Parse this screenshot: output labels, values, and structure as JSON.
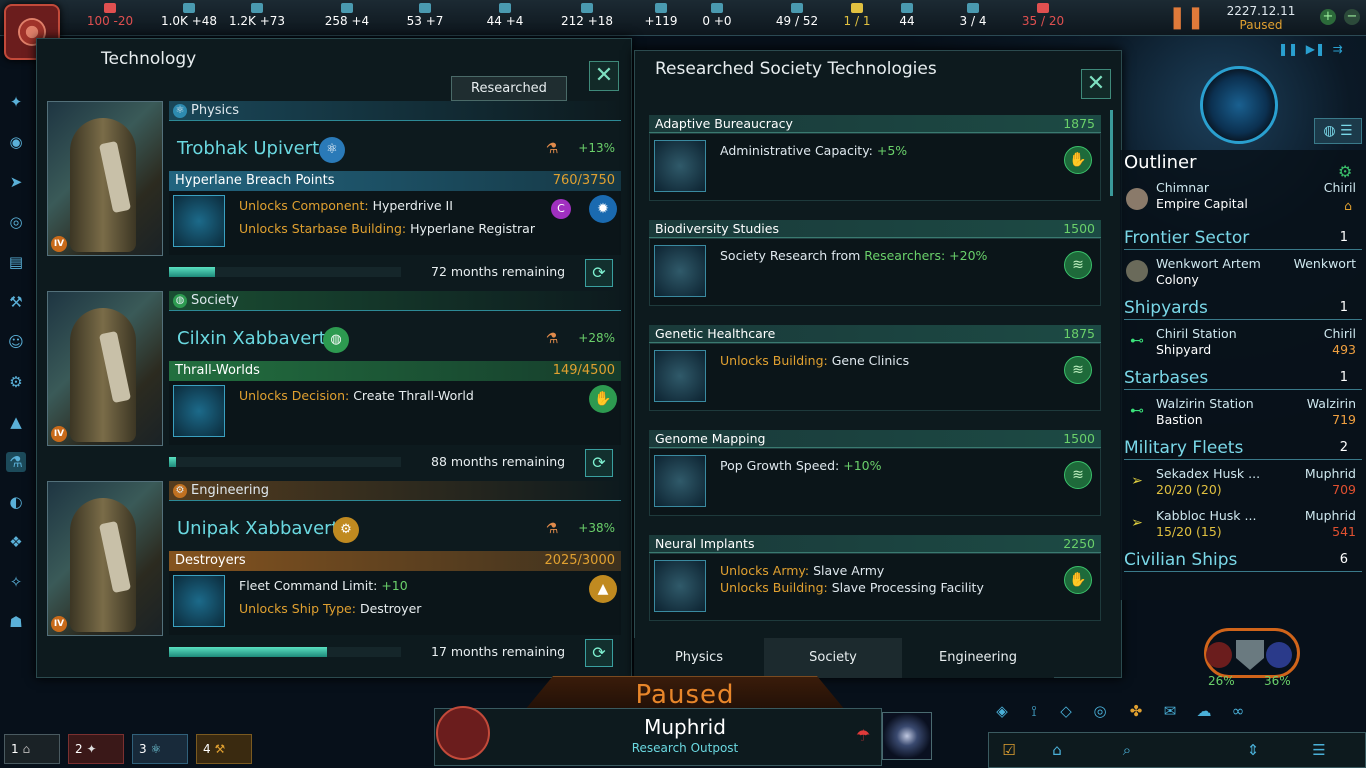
{
  "top_bar": {
    "resources": [
      {
        "name": "energy",
        "value": "100 -20",
        "color": "#e05050",
        "icon": "energy-icon"
      },
      {
        "name": "minerals",
        "value": "1.0K +48",
        "color": "#ffffff",
        "icon": "minerals-icon"
      },
      {
        "name": "food",
        "value": "1.2K +73",
        "color": "#ffffff",
        "icon": "food-icon"
      },
      {
        "name": "consumer_goods",
        "value": "258 +4",
        "color": "#ffffff",
        "icon": "consumer-goods-icon"
      },
      {
        "name": "alloys",
        "value": "53 +7",
        "color": "#ffffff",
        "icon": "alloys-icon"
      },
      {
        "name": "influence",
        "value": "44 +4",
        "color": "#ffffff",
        "icon": "influence-icon"
      },
      {
        "name": "unity",
        "value": "212 +18",
        "color": "#ffffff",
        "icon": "unity-icon"
      },
      {
        "name": "research",
        "value": "+119",
        "color": "#ffffff",
        "icon": "research-icon"
      },
      {
        "name": "trade",
        "value": "0 +0",
        "color": "#ffffff",
        "icon": "trade-icon"
      },
      {
        "name": "naval_capacity",
        "value": "49 / 52",
        "color": "#ffffff",
        "icon": "fleet-icon"
      },
      {
        "name": "starbase_capacity",
        "value": "1 / 1",
        "color": "#e0c040",
        "icon": "starbase-icon"
      },
      {
        "name": "pops",
        "value": "44",
        "color": "#ffffff",
        "icon": "pop-icon"
      },
      {
        "name": "colonies",
        "value": "3 / 4",
        "color": "#ffffff",
        "icon": "colony-icon"
      },
      {
        "name": "empire_sprawl",
        "value": "35 / 20",
        "color": "#e05050",
        "icon": "sprawl-icon"
      }
    ],
    "date": "2227.12.11",
    "status": "Paused"
  },
  "tech_panel": {
    "title": "Technology",
    "researched_button": "Researched",
    "rows": [
      {
        "area": "Physics",
        "area_color": "#2d8ab0",
        "scientist": "Trobhak Upiverta",
        "bonus": "+13%",
        "project": "Hyperlane Breach Points",
        "progress_text": "760/3750",
        "progress": 0.2,
        "unlocks": [
          {
            "key": "Unlocks Component:",
            "value": "Hyperdrive II"
          },
          {
            "key": "Unlocks Starbase Building:",
            "value": "Hyperlane Registrar"
          }
        ],
        "remaining": "72 months remaining",
        "rank": "IV"
      },
      {
        "area": "Society",
        "area_color": "#2d9a50",
        "scientist": "Cilxin Xabbaverta",
        "bonus": "+28%",
        "project": "Thrall-Worlds",
        "progress_text": "149/4500",
        "progress": 0.03,
        "unlocks": [
          {
            "key": "Unlocks Decision:",
            "value": "Create Thrall-World"
          }
        ],
        "remaining": "88 months remaining",
        "rank": "IV"
      },
      {
        "area": "Engineering",
        "area_color": "#c07020",
        "scientist": "Unipak Xabbaverta",
        "bonus": "+38%",
        "project": "Destroyers",
        "progress_text": "2025/3000",
        "progress": 0.68,
        "unlocks": [
          {
            "key": "Fleet Command Limit:",
            "value": "+10"
          },
          {
            "key": "Unlocks Ship Type:",
            "value": "Destroyer"
          }
        ],
        "remaining": "17 months remaining",
        "rank": "IV"
      }
    ]
  },
  "researched_panel": {
    "title": "Researched Society Technologies",
    "techs": [
      {
        "name": "Adaptive Bureaucracy",
        "cost": "1875",
        "lines": [
          {
            "k": "Administrative Capacity:",
            "v": "+5%"
          }
        ]
      },
      {
        "name": "Biodiversity Studies",
        "cost": "1500",
        "lines": [
          {
            "k": "Society Research from",
            "v": "Researchers: +20%"
          }
        ]
      },
      {
        "name": "Genetic Healthcare",
        "cost": "1875",
        "lines": [
          {
            "k": "Unlocks Building:",
            "v": "Gene Clinics"
          }
        ]
      },
      {
        "name": "Genome Mapping",
        "cost": "1500",
        "lines": [
          {
            "k": "Pop Growth Speed:",
            "v": "+10%"
          }
        ]
      },
      {
        "name": "Neural Implants",
        "cost": "2250",
        "lines": [
          {
            "k": "Unlocks Army:",
            "v": "Slave Army"
          },
          {
            "k": "Unlocks Building:",
            "v": "Slave Processing Facility"
          }
        ]
      }
    ],
    "tabs": [
      "Physics",
      "Society",
      "Engineering"
    ],
    "active_tab": "Society"
  },
  "outliner": {
    "title": "Outliner",
    "capital": {
      "planet": "Chimnar",
      "system": "Chiril",
      "label": "Empire Capital"
    },
    "sections": [
      {
        "name": "Frontier Sector",
        "count": "1",
        "items": [
          {
            "a": "Wenkwort Artem",
            "b": "Colony",
            "c": "Wenkwort",
            "d": ""
          }
        ]
      },
      {
        "name": "Shipyards",
        "count": "1",
        "items": [
          {
            "a": "Chiril Station",
            "b": "Shipyard",
            "c": "Chiril",
            "d": "493"
          }
        ]
      },
      {
        "name": "Starbases",
        "count": "1",
        "items": [
          {
            "a": "Walzirin Station",
            "b": "Bastion",
            "c": "Walzirin",
            "d": "719"
          }
        ]
      },
      {
        "name": "Military Fleets",
        "count": "2",
        "items": [
          {
            "a": "Sekadex Husk ...",
            "b": "20/20 (20)",
            "c": "Muphrid",
            "d": "709"
          },
          {
            "a": "Kabbloc Husk ...",
            "b": "15/20 (15)",
            "c": "Muphrid",
            "d": "541"
          }
        ]
      },
      {
        "name": "Civilian Ships",
        "count": "6",
        "items": []
      }
    ]
  },
  "bottom": {
    "paused": "Paused",
    "planet_name": "Muphrid",
    "planet_type": "Research Outpost",
    "hotkeys": [
      "1",
      "2",
      "3",
      "4"
    ],
    "percent_left": "26%",
    "percent_right": "36%"
  }
}
